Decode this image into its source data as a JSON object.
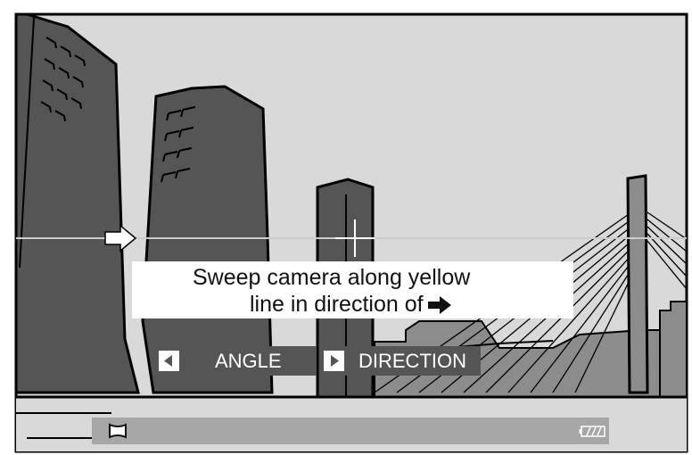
{
  "instructions": {
    "line1": "Sweep camera along yellow",
    "line2": "line in direction of"
  },
  "controls": {
    "left_key_icon": "left-triangle-icon",
    "angle_label": "ANGLE",
    "right_key_icon": "right-triangle-icon",
    "direction_label": "DIRECTION"
  },
  "status": {
    "mode_icon": "panorama-mode-icon",
    "battery_icon": "battery-icon"
  },
  "colors": {
    "sky": "#d9d9d9",
    "building_dark": "#555555",
    "building_mid": "#8c8c8c",
    "guide_line": "#cccccc",
    "status_bar": "#a6a6a6",
    "text": "#111111"
  }
}
